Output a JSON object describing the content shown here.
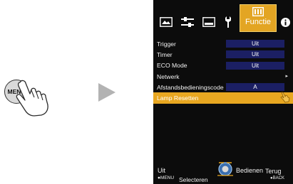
{
  "illustration": {
    "menu_button_label": "MENU",
    "icons": [
      "hand-press-icon",
      "play-arrow-icon"
    ]
  },
  "tabs": [
    {
      "icon": "picture-icon"
    },
    {
      "icon": "adjust-icon"
    },
    {
      "icon": "screen-icon"
    },
    {
      "icon": "installation-icon"
    },
    {
      "icon": "function-icon",
      "label": "Functie",
      "active": true
    },
    {
      "icon": "info-icon"
    }
  ],
  "menu": {
    "items": [
      {
        "label": "Trigger",
        "value": "Uit"
      },
      {
        "label": "Timer",
        "value": "Uit"
      },
      {
        "label": "ECO Mode",
        "value": "Uit"
      },
      {
        "label": "Netwerk",
        "arrow": "▸"
      },
      {
        "label": "Afstandsbedieningscode",
        "value": "A"
      },
      {
        "label": "Lamp Resetten",
        "arrow": "▸",
        "selected": true
      }
    ]
  },
  "footer": {
    "uit": "Uit",
    "menu": "●MENU",
    "selecteren": "Selecteren",
    "bedienen": "Bedienen",
    "terug": "Terug",
    "back": "●BACK"
  },
  "colors": {
    "osd_background": "#0c0c0c",
    "value_background": "#1b1f63",
    "accent": "#e8a721"
  }
}
